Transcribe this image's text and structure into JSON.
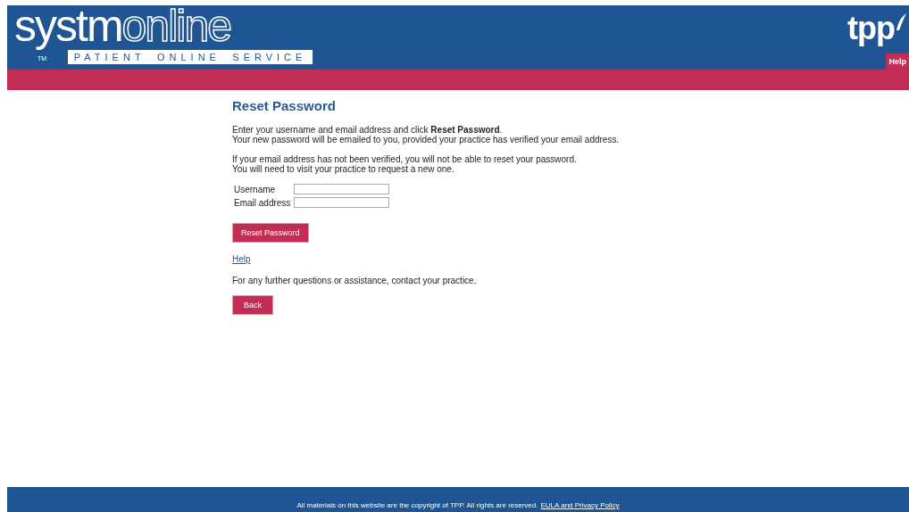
{
  "header": {
    "logo": {
      "solid": "systm",
      "outline": "online",
      "trademark": "TM",
      "tagline": [
        "PATIENT",
        "ONLINE",
        "SERVICE"
      ]
    },
    "brand": "tpp",
    "help_button": "Help"
  },
  "content": {
    "title": "Reset Password",
    "intro": [
      "Enter your username and email address and click **Reset Password**.",
      "Your new password will be emailed to you, provided your practice has verified your email address."
    ],
    "note": [
      "If your email address has not been verified, you will not be able to reset your password.",
      "You will need to visit your practice to request a new one."
    ],
    "fields": [
      {
        "label": "Username"
      },
      {
        "label": "Email address"
      }
    ],
    "submit_button": "Reset Password",
    "help_link": "Help",
    "contact_text": "For any further questions or assistance, contact your practice.",
    "back_button": "Back"
  },
  "footer": {
    "text": "All materials on this website are the copyright of TPP. All rights are reserved.",
    "link": "EULA and Privacy Policy"
  }
}
